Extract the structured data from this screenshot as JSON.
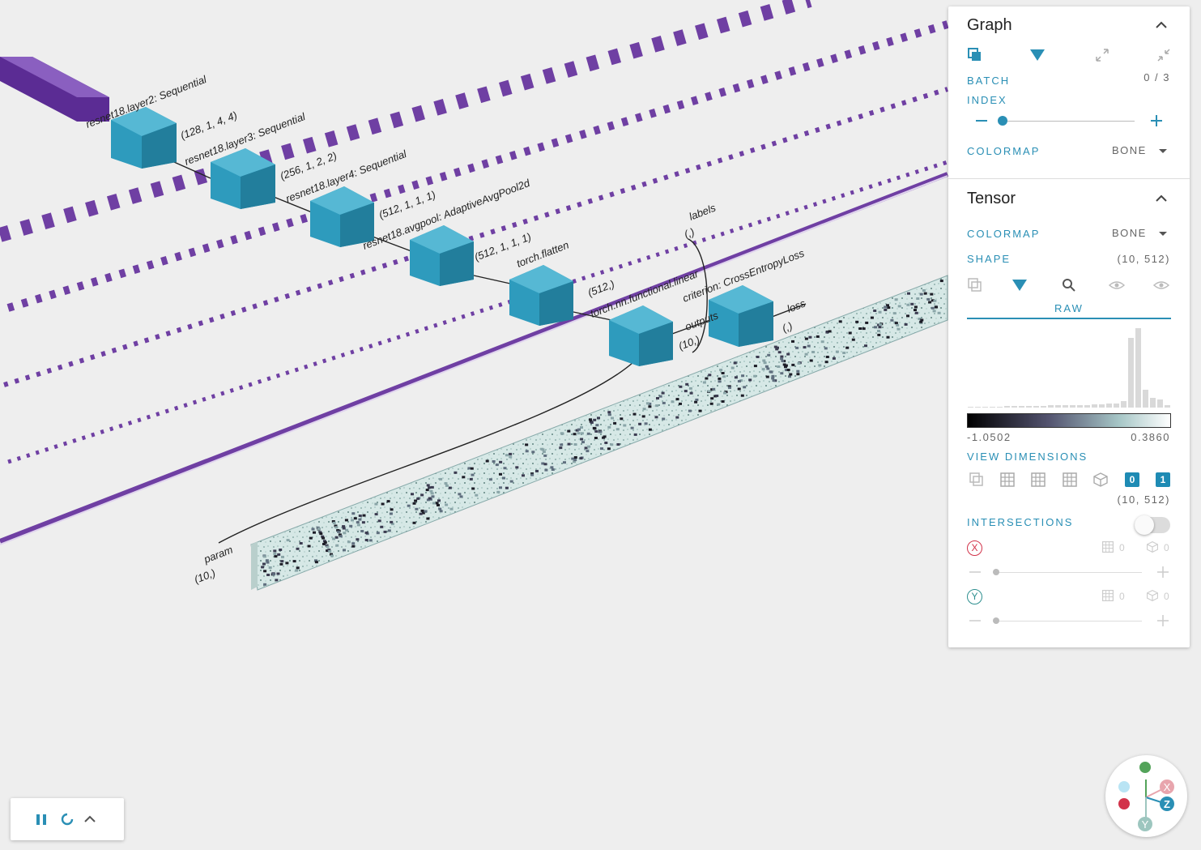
{
  "graph": {
    "nodes": [
      {
        "label": "resnet18.layer2: Sequential",
        "shape": "(128, 1, 4, 4)"
      },
      {
        "label": "resnet18.layer3: Sequential",
        "shape": "(256, 1, 2, 2)"
      },
      {
        "label": "resnet18.layer4: Sequential",
        "shape": "(512, 1, 1, 1)"
      },
      {
        "label": "resnet18.avgpool: AdaptiveAvgPool2d",
        "shape": "(512, 1, 1, 1)"
      },
      {
        "label": "torch.flatten",
        "shape": "(512,)"
      },
      {
        "label": "torch.nn.functional.linear",
        "shape": "(10,)"
      },
      {
        "label": "criterion: CrossEntropyLoss",
        "shape": "(,)"
      }
    ],
    "outputs_label": "outputs",
    "labels_label": "labels",
    "labels_shape": "(,)",
    "loss_label": "loss",
    "param_label": "param",
    "param_shape": "(10,)",
    "colors": {
      "cube": "#2e9bbd",
      "edge_purple": "#6f3fa3",
      "tensor_bg": "#d6e8e6"
    }
  },
  "panel": {
    "graph": {
      "title": "Graph",
      "batch_index_label": "BATCH INDEX",
      "batch_value": "0 / 3",
      "batch_fraction": 0.0,
      "colormap_label": "COLORMAP",
      "colormap_value": "BONE",
      "icons": [
        "stack-icon",
        "filter-icon",
        "expand-icon",
        "collapse-icon"
      ]
    },
    "tensor": {
      "title": "Tensor",
      "colormap_label": "COLORMAP",
      "colormap_value": "BONE",
      "shape_label": "SHAPE",
      "shape_value": "(10, 512)",
      "tab_label": "RAW",
      "range_min": "-1.0502",
      "range_max": "0.3860",
      "view_dimensions_label": "VIEW DIMENSIONS",
      "dims": [
        "0",
        "1"
      ],
      "dims_shape": "(10, 512)",
      "intersections_label": "INTERSECTIONS",
      "intersections_on": false,
      "axis_x": "X",
      "axis_y": "Y",
      "axis_count_x_grid": "0",
      "axis_count_x_cube": "0",
      "axis_count_y_grid": "0",
      "axis_count_y_cube": "0",
      "histogram": [
        0.01,
        0.01,
        0.01,
        0.01,
        0.01,
        0.02,
        0.02,
        0.02,
        0.02,
        0.02,
        0.02,
        0.03,
        0.03,
        0.03,
        0.03,
        0.03,
        0.03,
        0.04,
        0.04,
        0.05,
        0.05,
        0.08,
        0.86,
        0.98,
        0.22,
        0.12,
        0.1,
        0.03
      ]
    }
  },
  "player": {
    "icons": [
      "pause-icon",
      "reload-icon",
      "chevron-up-icon"
    ]
  },
  "gizmo": {
    "x_label": "X",
    "y_label": "Y",
    "z_label": "Z"
  }
}
